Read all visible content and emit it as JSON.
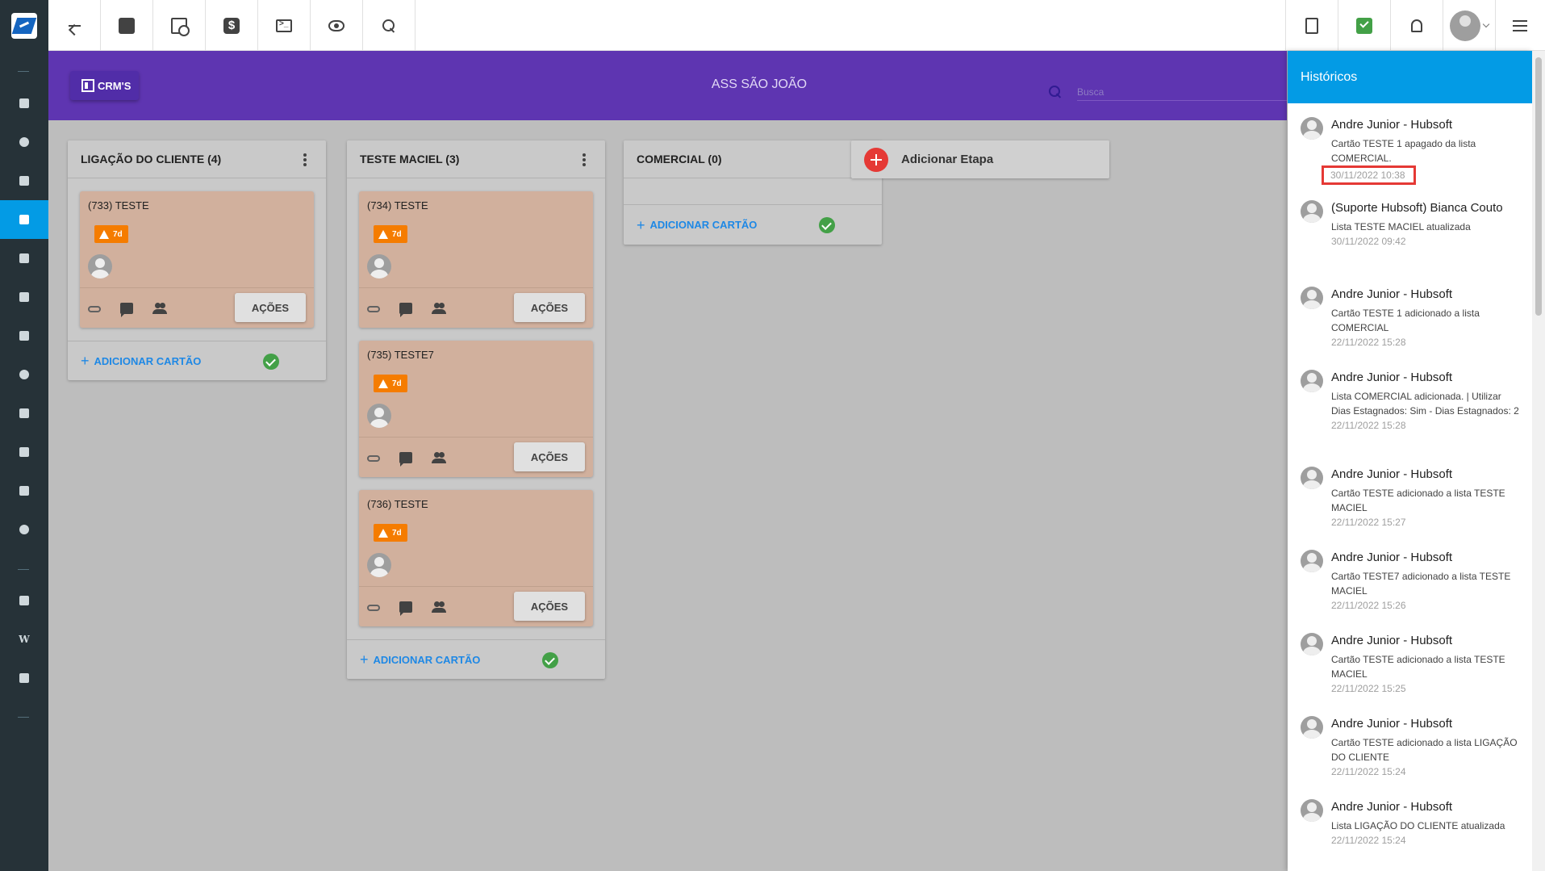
{
  "topbar": {
    "left_icons": [
      "back-arrow-icon",
      "contact-card-icon",
      "calendar-clock-icon",
      "dollar-icon",
      "terminal-icon",
      "eye-icon",
      "search-icon"
    ],
    "right_icons": [
      "pdf-file-icon",
      "chat-check-icon",
      "bell-icon",
      "user-avatar",
      "menu-list-icon"
    ]
  },
  "sidebar": {
    "icons": [
      "dashboard-icon",
      "palette-icon",
      "contact-icon",
      "kanban-icon",
      "calendar-icon",
      "box-icon",
      "money-icon",
      "location-icon",
      "document-icon",
      "server-icon",
      "file-icon",
      "settings-icon",
      "video-icon",
      "wiki-icon",
      "chat-icon"
    ],
    "active": "kanban-icon"
  },
  "header": {
    "crm_label": "CRM'S",
    "title": "ASS SÃO JOÃO",
    "search_placeholder": "Busca"
  },
  "columns": [
    {
      "title": "LIGAÇÃO DO CLIENTE (4)",
      "cards": [
        {
          "title": "(733) TESTE",
          "badge": "7d",
          "action": "AÇÕES"
        }
      ],
      "add_label": "ADICIONAR CARTÃO"
    },
    {
      "title": "TESTE MACIEL (3)",
      "cards": [
        {
          "title": "(734) TESTE",
          "badge": "7d",
          "action": "AÇÕES"
        },
        {
          "title": "(735) TESTE7",
          "badge": "7d",
          "action": "AÇÕES"
        },
        {
          "title": "(736) TESTE",
          "badge": "7d",
          "action": "AÇÕES"
        }
      ],
      "add_label": "ADICIONAR CARTÃO"
    },
    {
      "title": "COMERCIAL (0)",
      "cards": [],
      "add_label": "ADICIONAR CARTÃO"
    }
  ],
  "add_stage_label": "Adicionar Etapa",
  "history": {
    "title": "Históricos",
    "items": [
      {
        "name": "Andre Junior - Hubsoft",
        "desc": "Cartão TESTE 1 apagado da lista COMERCIAL.",
        "time": "30/11/2022 10:38",
        "highlighted": true
      },
      {
        "name": "(Suporte Hubsoft) Bianca Couto",
        "desc": "Lista TESTE MACIEL atualizada",
        "time": "30/11/2022 09:42"
      },
      {
        "name": "Andre Junior - Hubsoft",
        "desc": "Cartão TESTE 1 adicionado a lista COMERCIAL",
        "time": "22/11/2022 15:28"
      },
      {
        "name": "Andre Junior - Hubsoft",
        "desc": "Lista COMERCIAL adicionada. | Utilizar Dias Estagnados: Sim - Dias Estagnados: 2",
        "time": "22/11/2022 15:28"
      },
      {
        "name": "Andre Junior - Hubsoft",
        "desc": "Cartão TESTE adicionado a lista TESTE MACIEL",
        "time": "22/11/2022 15:27"
      },
      {
        "name": "Andre Junior - Hubsoft",
        "desc": "Cartão TESTE7 adicionado a lista TESTE MACIEL",
        "time": "22/11/2022 15:26"
      },
      {
        "name": "Andre Junior - Hubsoft",
        "desc": "Cartão TESTE adicionado a lista TESTE MACIEL",
        "time": "22/11/2022 15:25"
      },
      {
        "name": "Andre Junior - Hubsoft",
        "desc": "Cartão TESTE adicionado a lista LIGAÇÃO DO CLIENTE",
        "time": "22/11/2022 15:24"
      },
      {
        "name": "Andre Junior - Hubsoft",
        "desc": "Lista LIGAÇÃO DO CLIENTE atualizada",
        "time": "22/11/2022 15:24"
      }
    ]
  },
  "colors": {
    "purple_header": "#5e35b1",
    "history_header": "#039be5",
    "card_bg": "#d1b09d",
    "badge": "#f57c00",
    "add_link": "#1e88e5",
    "highlight_box": "#e53935"
  }
}
